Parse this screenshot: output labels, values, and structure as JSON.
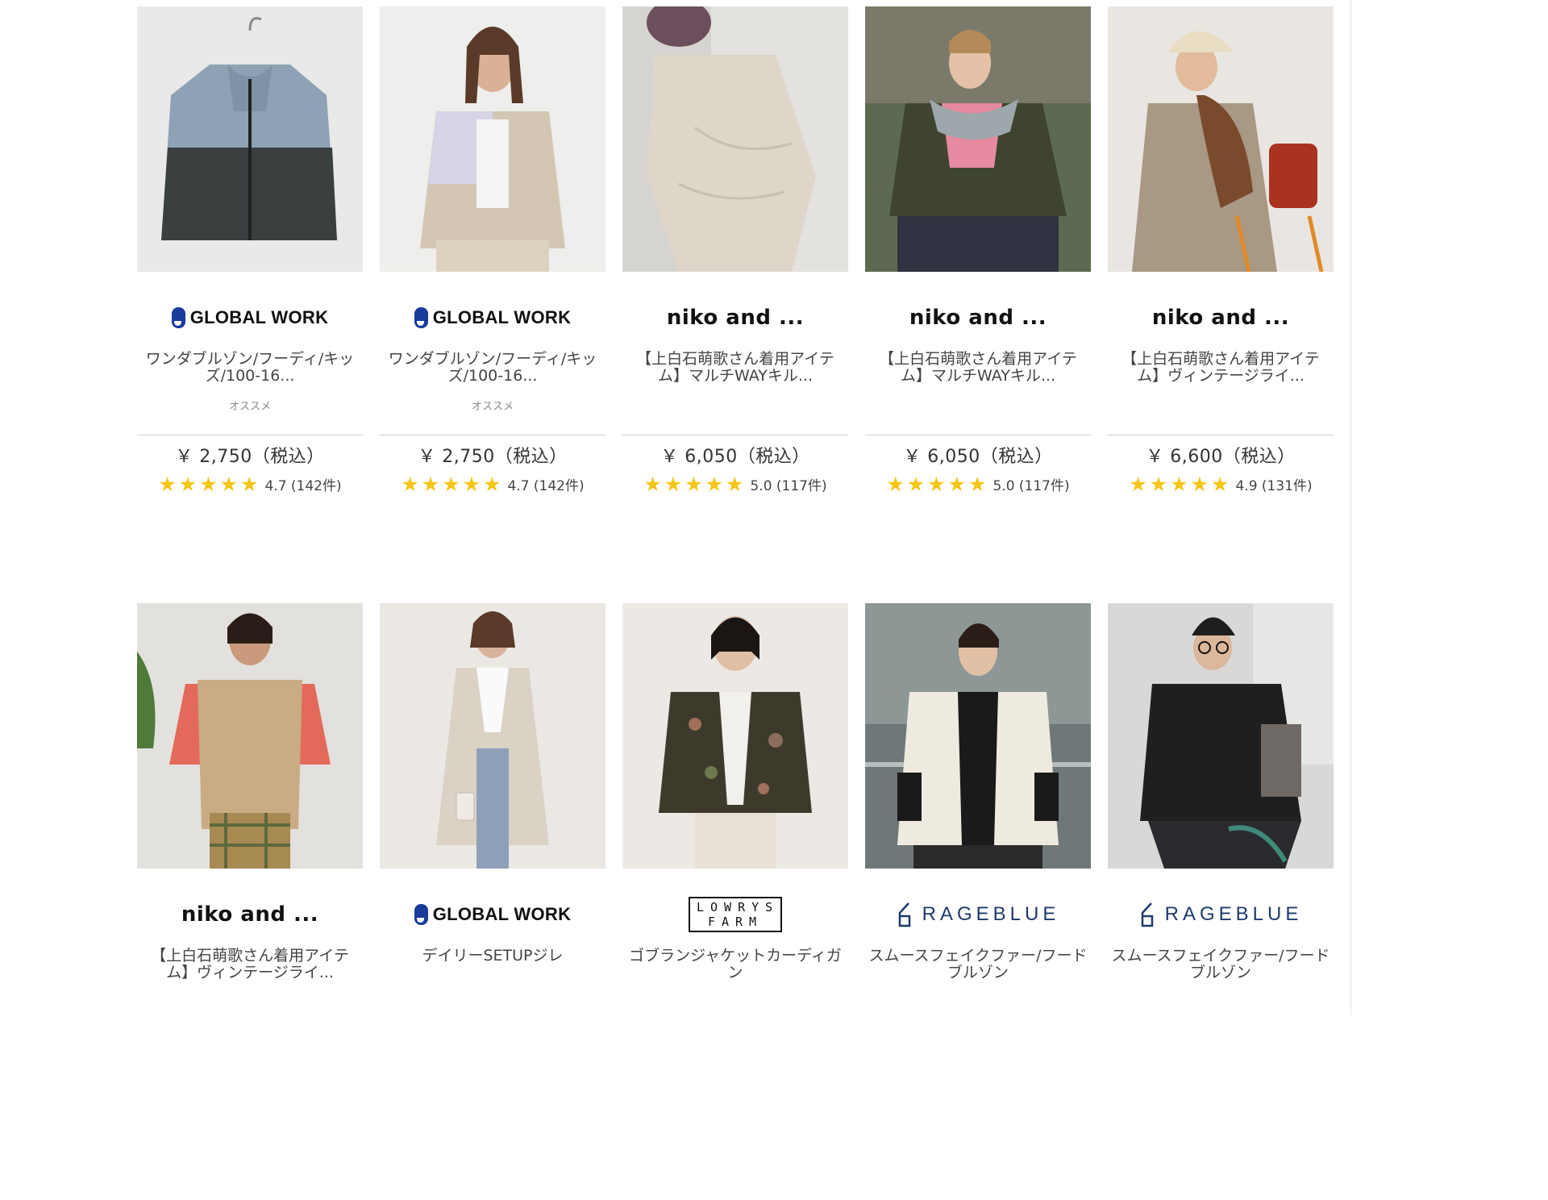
{
  "colors": {
    "star": "#f5c518",
    "global_work_blue": "#1a3a9c",
    "rageblue_navy": "#1e3a6e",
    "divider": "#cfcfcf"
  },
  "products": [
    {
      "brand": "GLOBAL WORK",
      "brand_style": "global-work",
      "name": "ワンダブルゾン/フーディ/キッズ/100-16...",
      "tag": "オススメ",
      "price": "￥ 2,750（税込）",
      "rating_count": "4.7 (142件)",
      "image": "blue-grey windbreaker hoodie on hanger"
    },
    {
      "brand": "GLOBAL WORK",
      "brand_style": "global-work",
      "name": "ワンダブルゾン/フーディ/キッズ/100-16...",
      "tag": "オススメ",
      "price": "￥ 2,750（税込）",
      "rating_count": "4.7 (142件)",
      "image": "girl in beige and lavender hoodie jacket"
    },
    {
      "brand": "niko and ...",
      "brand_style": "niko",
      "name": "【上白石萌歌さん着用アイテム】マルチWAYキル...",
      "tag": "",
      "price": "￥ 6,050（税込）",
      "rating_count": "5.0 (117件)",
      "image": "woman in cream quilted coat"
    },
    {
      "brand": "niko and ...",
      "brand_style": "niko",
      "name": "【上白石萌歌さん着用アイテム】マルチWAYキル...",
      "tag": "",
      "price": "￥ 6,050（税込）",
      "rating_count": "5.0 (117件)",
      "image": "woman in khaki quilted jacket"
    },
    {
      "brand": "niko and ...",
      "brand_style": "niko",
      "name": "【上白石萌歌さん着用アイテム】ヴィンテージライ...",
      "tag": "",
      "price": "￥ 6,600（税込）",
      "rating_count": "4.9 (131件)",
      "image": "woman in brown fur vest and cap"
    },
    {
      "brand": "niko and ...",
      "brand_style": "niko",
      "name": "【上白石萌歌さん着用アイテム】ヴィンテージライ...",
      "tag": "",
      "price": "",
      "rating_count": "",
      "image": "woman in fur vest and coral sweater"
    },
    {
      "brand": "GLOBAL WORK",
      "brand_style": "global-work",
      "name": "デイリーSETUPジレ",
      "tag": "",
      "price": "",
      "rating_count": "",
      "image": "woman in long ivory gilet"
    },
    {
      "brand": "LOWRYS FARM",
      "brand_style": "lowrys",
      "name": "ゴブランジャケットカーディガン",
      "tag": "",
      "price": "",
      "rating_count": "",
      "image": "woman in floral gobelin jacket"
    },
    {
      "brand": "RAGEBLUE",
      "brand_style": "rageblue",
      "name": "スムースフェイクファー/フードブルゾン",
      "tag": "",
      "price": "",
      "rating_count": "",
      "image": "man in white faux fur hoodie"
    },
    {
      "brand": "RAGEBLUE",
      "brand_style": "rageblue",
      "name": "スムースフェイクファー/フードブルゾン",
      "tag": "",
      "price": "",
      "rating_count": "",
      "image": "man in black faux fur hoodie"
    }
  ]
}
